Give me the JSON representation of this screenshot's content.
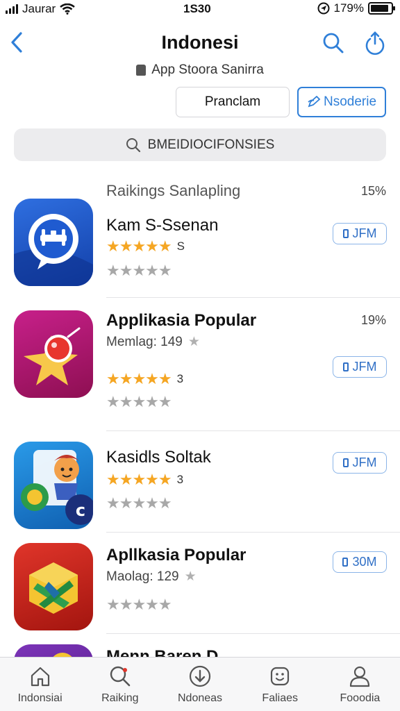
{
  "status_bar": {
    "carrier": "Jaurar",
    "time": "1S30",
    "battery": "179%",
    "battery_level": 0.9
  },
  "header": {
    "title": "Indonesi",
    "subtitle": "App Stoora Sanirra"
  },
  "segments": {
    "left_label": "Pranclam",
    "right_label": "Nsoderie"
  },
  "search": {
    "placeholder": "BMEIDIOCIFONSIES"
  },
  "section": {
    "title": "Raikings Sanlapling",
    "percent": "15%"
  },
  "apps": [
    {
      "name": "Kam S-Ssenan",
      "rating_count": "S",
      "get_label": "JFM",
      "icon": "chat-bubble-icon",
      "color": "#1d4fc4"
    },
    {
      "name": "Applikasia Popular",
      "meta": "Memlag: 149",
      "percent": "19%",
      "rating_count": "3",
      "get_label": "JFM",
      "icon": "rocket-star-icon",
      "color": "#b5156e"
    },
    {
      "name": "Kasidls Soltak",
      "rating_count": "3",
      "get_label": "JFM",
      "icon": "game-character-icon",
      "color": "#1a86d6"
    },
    {
      "name": "Apllkasia Popular",
      "meta": "Maolag: 129",
      "get_label": "30M",
      "icon": "cube-icon",
      "color": "#c8261b"
    },
    {
      "name": "Menn Baren D",
      "icon": "app-icon",
      "color": "#6b2aa6"
    }
  ],
  "tabs": [
    {
      "label": "Indonsiai",
      "icon": "home-icon"
    },
    {
      "label": "Raiking",
      "icon": "search-icon"
    },
    {
      "label": "Ndoneas",
      "icon": "download-icon"
    },
    {
      "label": "Faliaes",
      "icon": "apps-icon"
    },
    {
      "label": "Fooodia",
      "icon": "profile-icon"
    }
  ]
}
